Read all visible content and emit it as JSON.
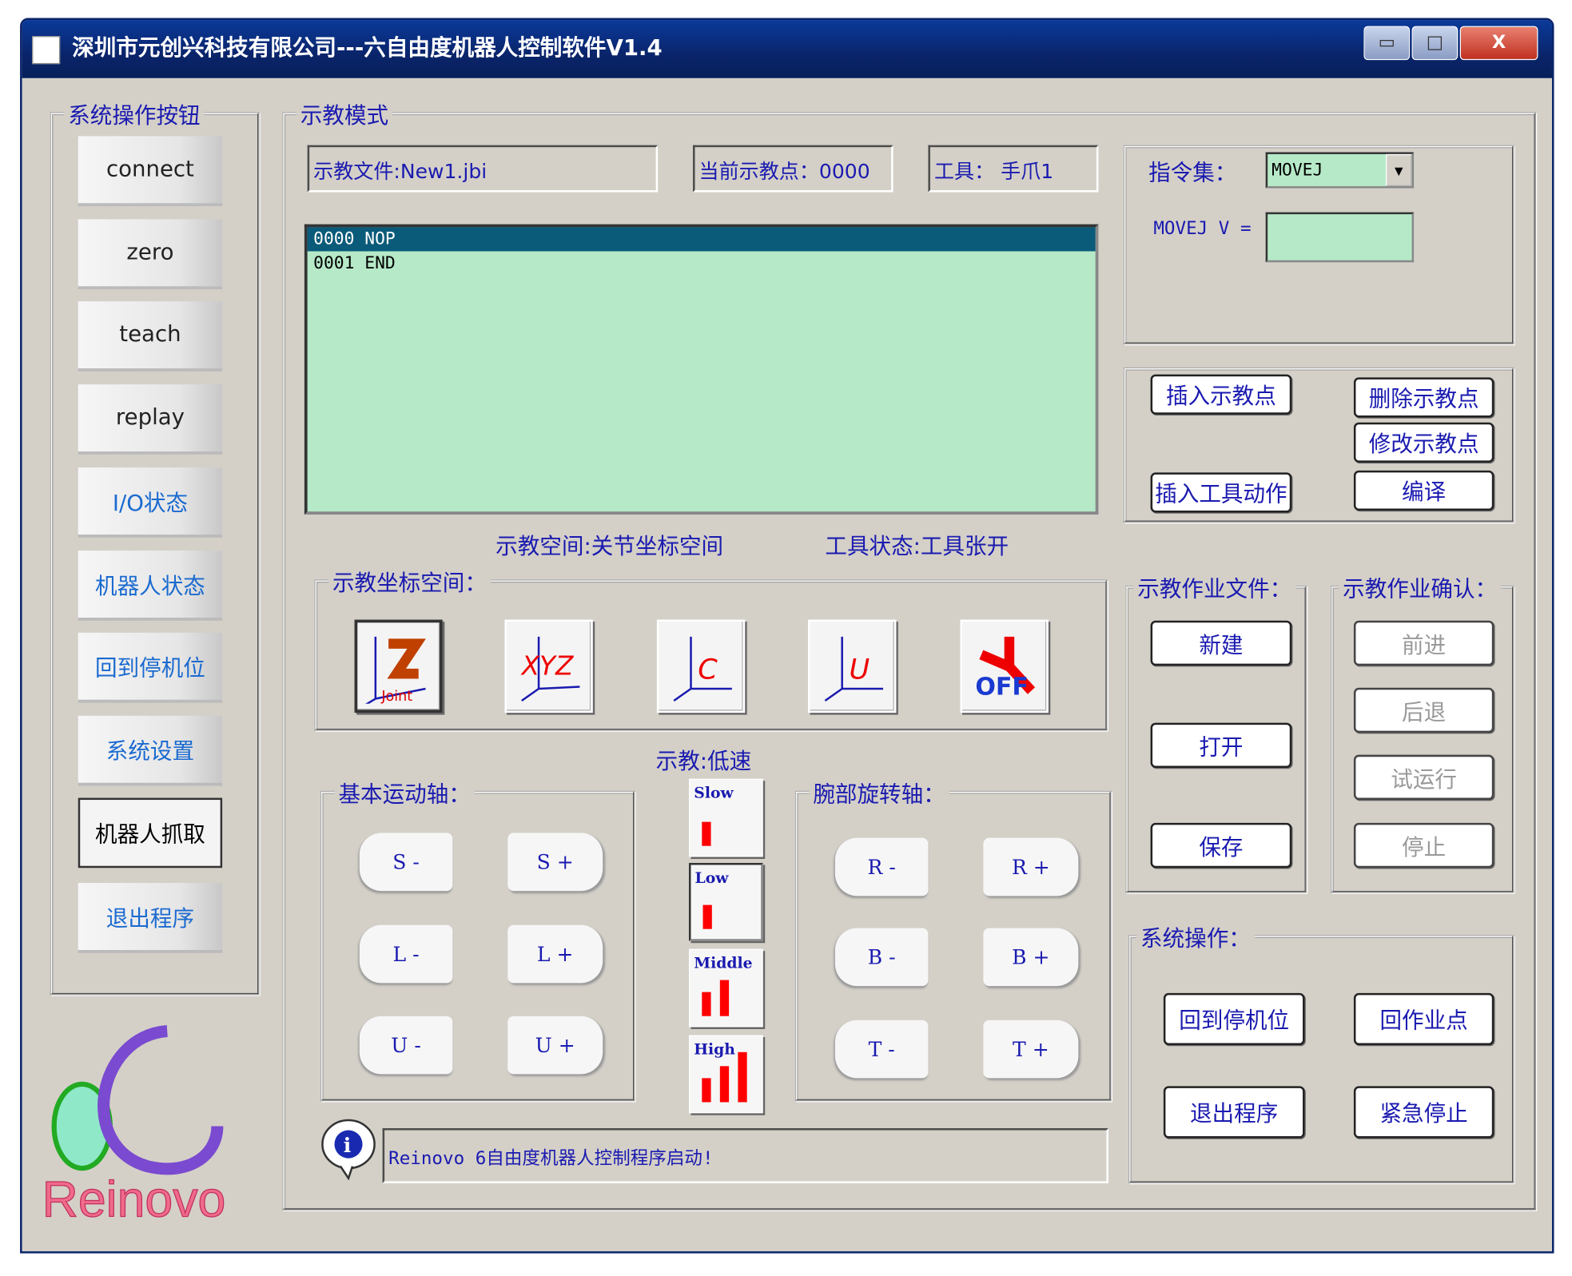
{
  "window": {
    "title": "深圳市元创兴科技有限公司---六自由度机器人控制软件V1.4",
    "minimize": "▭",
    "maximize": "□",
    "close": "X"
  },
  "sidebar": {
    "legend": "系统操作按钮",
    "buttons": [
      "connect",
      "zero",
      "teach",
      "replay",
      "I/O状态",
      "机器人状态",
      "回到停机位",
      "系统设置",
      "机器人抓取",
      "退出程序"
    ]
  },
  "logo": {
    "text": "Reinovo"
  },
  "main": {
    "legend": "示教模式",
    "file_field": "示教文件:New1.jbi",
    "point_field": "当前示教点：0000",
    "tool_field": "工具：  手爪1",
    "program": [
      {
        "text": "0000  NOP",
        "selected": true
      },
      {
        "text": "0001  END",
        "selected": false
      }
    ],
    "space_status": "示教空间:关节坐标空间",
    "tool_status": "工具状态:工具张开",
    "coord_legend": "示教坐标空间：",
    "coord_icons": [
      {
        "name": "joint",
        "label": "Joint"
      },
      {
        "name": "xyz",
        "label": "XYZ"
      },
      {
        "name": "cylinder",
        "label": "C"
      },
      {
        "name": "user",
        "label": "U"
      },
      {
        "name": "tool-off",
        "label": "OFF"
      }
    ],
    "speed_status": "示教:低速",
    "speeds": [
      {
        "label": "Slow",
        "bars": 1
      },
      {
        "label": "Low",
        "bars": 1
      },
      {
        "label": "Middle",
        "bars": 2
      },
      {
        "label": "High",
        "bars": 3
      }
    ],
    "basic_legend": "基本运动轴：",
    "basic_axes": [
      [
        "S -",
        "S +"
      ],
      [
        "L -",
        "L +"
      ],
      [
        "U -",
        "U +"
      ]
    ],
    "wrist_legend": "腕部旋转轴：",
    "wrist_axes": [
      [
        "R -",
        "R +"
      ],
      [
        "B -",
        "B +"
      ],
      [
        "T -",
        "T +"
      ]
    ],
    "message": "Reinovo 6自由度机器人控制程序启动!"
  },
  "instruction": {
    "set_label": "指令集：",
    "set_value": "MOVEJ",
    "v_label": "MOVEJ V =",
    "v_value": ""
  },
  "edit_buttons": {
    "insert_point": "插入示教点",
    "delete_point": "删除示教点",
    "modify_point": "修改示教点",
    "insert_tool": "插入工具动作",
    "compile": "编译"
  },
  "job_file": {
    "legend": "示教作业文件：",
    "new": "新建",
    "open": "打开",
    "save": "保存"
  },
  "job_confirm": {
    "legend": "示教作业确认：",
    "forward": "前进",
    "back": "后退",
    "trial": "试运行",
    "stop": "停止"
  },
  "system_ops": {
    "legend": "系统操作：",
    "home": "回到停机位",
    "work_point": "回作业点",
    "exit": "退出程序",
    "estop": "紧急停止"
  }
}
